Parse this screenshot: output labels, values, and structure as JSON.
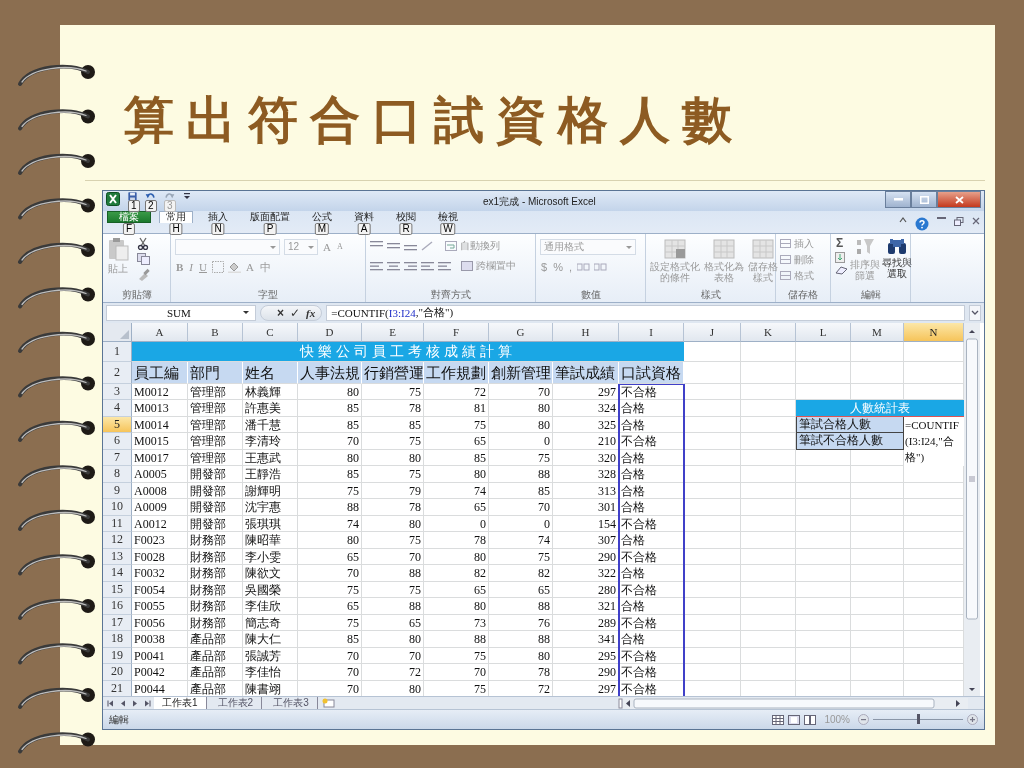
{
  "slide": {
    "title": "算出符合口試資格人數"
  },
  "window": {
    "title": "ex1完成 - Microsoft Excel"
  },
  "quick_access_keytips": [
    "1",
    "2",
    "3"
  ],
  "file_tab": {
    "label": "檔案",
    "keytip": "F"
  },
  "tabs": [
    {
      "label": "常用",
      "keytip": "H",
      "selected": true
    },
    {
      "label": "插入",
      "keytip": "N",
      "selected": false
    },
    {
      "label": "版面配置",
      "keytip": "P",
      "selected": false
    },
    {
      "label": "公式",
      "keytip": "M",
      "selected": false
    },
    {
      "label": "資料",
      "keytip": "A",
      "selected": false
    },
    {
      "label": "校閱",
      "keytip": "R",
      "selected": false
    },
    {
      "label": "檢視",
      "keytip": "W",
      "selected": false
    }
  ],
  "ribbon": {
    "groups": [
      {
        "label": "剪貼簿",
        "buttons": [
          "貼上"
        ]
      },
      {
        "label": "字型",
        "font_size": "12",
        "buttons": [
          "A",
          "A",
          "B",
          "I",
          "U",
          "A",
          "中"
        ]
      },
      {
        "label": "對齊方式",
        "buttons": [
          "自動換列",
          "跨欄置中"
        ]
      },
      {
        "label": "數值",
        "format": "通用格式",
        "buttons": [
          "$",
          "%",
          ","
        ]
      },
      {
        "label": "樣式",
        "buttons": [
          "設定格式化的條件",
          "格式化為表格",
          "儲存格樣式"
        ]
      },
      {
        "label": "儲存格",
        "buttons": [
          "插入",
          "刪除",
          "格式"
        ]
      },
      {
        "label": "編輯",
        "buttons": [
          "Σ",
          "排序與篩選",
          "尋找與選取"
        ]
      }
    ]
  },
  "formula_bar": {
    "name_box": "SUM",
    "buttons": [
      "×",
      "✓",
      "fx"
    ],
    "formula": [
      {
        "text": "=COUNTIF(",
        "kind": "plain"
      },
      {
        "text": "I3:I24",
        "kind": "reference"
      },
      {
        "text": ",\"合格\")",
        "kind": "plain"
      }
    ]
  },
  "sheet": {
    "columns": [
      {
        "label": "A",
        "selected": false
      },
      {
        "label": "B",
        "selected": false
      },
      {
        "label": "C",
        "selected": false
      },
      {
        "label": "D",
        "selected": false
      },
      {
        "label": "E",
        "selected": false
      },
      {
        "label": "F",
        "selected": false
      },
      {
        "label": "G",
        "selected": false
      },
      {
        "label": "H",
        "selected": false
      },
      {
        "label": "I",
        "selected": false
      },
      {
        "label": "J",
        "selected": false
      },
      {
        "label": "K",
        "selected": false
      },
      {
        "label": "L",
        "selected": false
      },
      {
        "label": "M",
        "selected": false
      },
      {
        "label": "N",
        "selected": true
      }
    ],
    "row_headers": [
      {
        "label": "1",
        "selected": false
      },
      {
        "label": "2",
        "selected": false
      },
      {
        "label": "3",
        "selected": false
      },
      {
        "label": "4",
        "selected": false
      },
      {
        "label": "5",
        "selected": true
      },
      {
        "label": "6",
        "selected": false
      },
      {
        "label": "7",
        "selected": false
      },
      {
        "label": "8",
        "selected": false
      },
      {
        "label": "9",
        "selected": false
      },
      {
        "label": "10",
        "selected": false
      },
      {
        "label": "11",
        "selected": false
      },
      {
        "label": "12",
        "selected": false
      },
      {
        "label": "13",
        "selected": false
      },
      {
        "label": "14",
        "selected": false
      },
      {
        "label": "15",
        "selected": false
      },
      {
        "label": "16",
        "selected": false
      },
      {
        "label": "17",
        "selected": false
      },
      {
        "label": "18",
        "selected": false
      },
      {
        "label": "19",
        "selected": false
      },
      {
        "label": "20",
        "selected": false
      },
      {
        "label": "21",
        "selected": false
      }
    ],
    "title": "快樂公司員工考核成績計算",
    "headers": [
      "員工編",
      "部門",
      "姓名",
      "人事法規",
      "行銷營運",
      "工作規劃",
      "創新管理",
      "筆試成績",
      "口試資格"
    ],
    "rows": [
      [
        "M0012",
        "管理部",
        "林義輝",
        "80",
        "75",
        "72",
        "70",
        "297",
        "不合格"
      ],
      [
        "M0013",
        "管理部",
        "許惠美",
        "85",
        "78",
        "81",
        "80",
        "324",
        "合格"
      ],
      [
        "M0014",
        "管理部",
        "潘千慧",
        "85",
        "85",
        "75",
        "80",
        "325",
        "合格"
      ],
      [
        "M0015",
        "管理部",
        "李清玲",
        "70",
        "75",
        "65",
        "0",
        "210",
        "不合格"
      ],
      [
        "M0017",
        "管理部",
        "王惠武",
        "80",
        "80",
        "85",
        "75",
        "320",
        "合格"
      ],
      [
        "A0005",
        "開發部",
        "王靜浩",
        "85",
        "75",
        "80",
        "88",
        "328",
        "合格"
      ],
      [
        "A0008",
        "開發部",
        "謝輝明",
        "75",
        "79",
        "74",
        "85",
        "313",
        "合格"
      ],
      [
        "A0009",
        "開發部",
        "沈宇惠",
        "88",
        "78",
        "65",
        "70",
        "301",
        "合格"
      ],
      [
        "A0012",
        "開發部",
        "張琪琪",
        "74",
        "80",
        "0",
        "0",
        "154",
        "不合格"
      ],
      [
        "F0023",
        "財務部",
        "陳昭華",
        "80",
        "75",
        "78",
        "74",
        "307",
        "合格"
      ],
      [
        "F0028",
        "財務部",
        "李小雯",
        "65",
        "70",
        "80",
        "75",
        "290",
        "不合格"
      ],
      [
        "F0032",
        "財務部",
        "陳欲文",
        "70",
        "88",
        "82",
        "82",
        "322",
        "合格"
      ],
      [
        "F0054",
        "財務部",
        "吳國榮",
        "75",
        "75",
        "65",
        "65",
        "280",
        "不合格"
      ],
      [
        "F0055",
        "財務部",
        "李佳欣",
        "65",
        "88",
        "80",
        "88",
        "321",
        "合格"
      ],
      [
        "F0056",
        "財務部",
        "簡志奇",
        "75",
        "65",
        "73",
        "76",
        "289",
        "不合格"
      ],
      [
        "P0038",
        "產品部",
        "陳大仁",
        "85",
        "80",
        "88",
        "88",
        "341",
        "合格"
      ],
      [
        "P0041",
        "產品部",
        "張誠芳",
        "70",
        "70",
        "75",
        "80",
        "295",
        "不合格"
      ],
      [
        "P0042",
        "產品部",
        "李佳怡",
        "70",
        "72",
        "70",
        "78",
        "290",
        "不合格"
      ],
      [
        "P0044",
        "產品部",
        "陳書翊",
        "70",
        "80",
        "75",
        "72",
        "297",
        "不合格"
      ]
    ],
    "summary": {
      "title": "人數統計表",
      "labels": [
        "筆試合格人數",
        "筆試不合格人數"
      ],
      "editing_value": "=COUNTIF(I3:I24,\"合格\")"
    }
  },
  "sheet_tabs": [
    {
      "label": "工作表1",
      "selected": true
    },
    {
      "label": "工作表2",
      "selected": false
    },
    {
      "label": "工作表3",
      "selected": false
    }
  ],
  "status_bar": {
    "mode": "編輯",
    "zoom": {
      "label": "100%",
      "level": 0.5
    }
  }
}
